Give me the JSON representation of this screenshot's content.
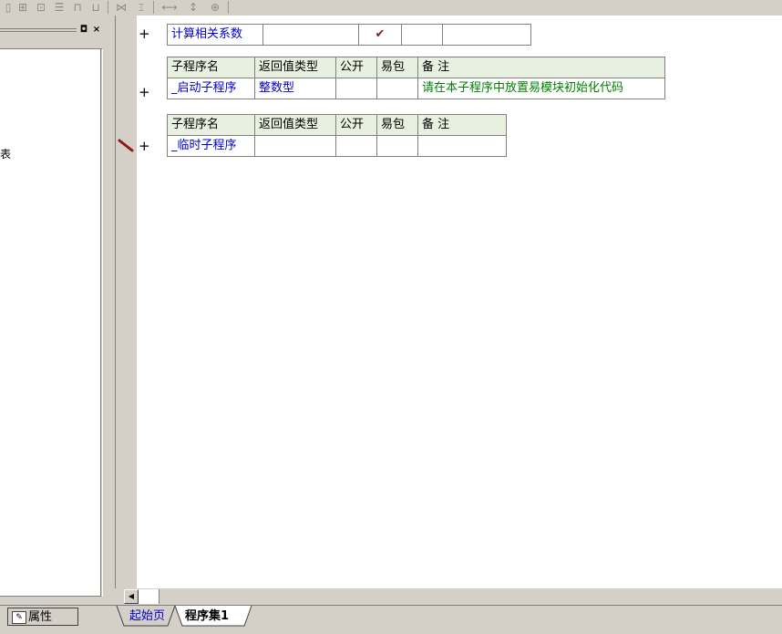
{
  "tables": {
    "t1": {
      "row": [
        "计算相关系数",
        "",
        "✔",
        "",
        ""
      ]
    },
    "t2": {
      "headers": [
        "子程序名",
        "返回值类型",
        "公开",
        "易包",
        "备 注"
      ],
      "row": [
        "_启动子程序",
        "整数型",
        "",
        "",
        "请在本子程序中放置易模块初始化代码"
      ]
    },
    "t3": {
      "headers": [
        "子程序名",
        "返回值类型",
        "公开",
        "易包",
        "备 注"
      ],
      "row": [
        "_临时子程序",
        "",
        "",
        "",
        ""
      ]
    }
  },
  "left_panel": {
    "fragment": "表",
    "property_tab": "属性"
  },
  "tabs": [
    "起始页",
    "程序集1"
  ],
  "plus_sign": "+"
}
